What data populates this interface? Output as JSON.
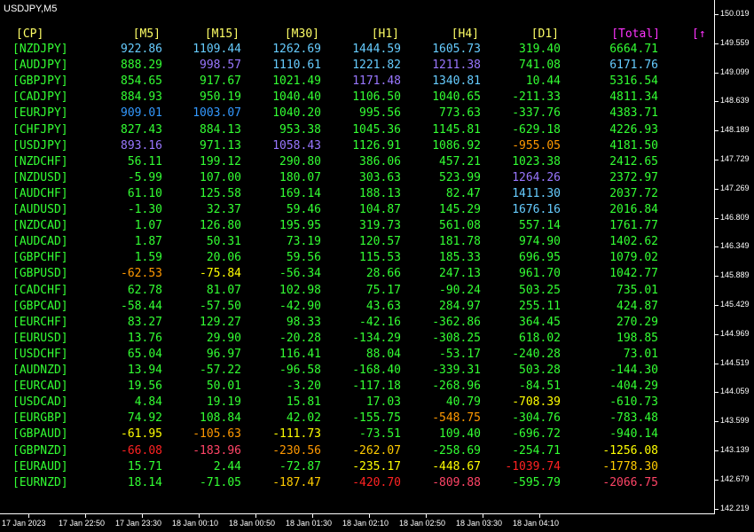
{
  "chart": {
    "title": "USDJPY,M5"
  },
  "colors": {
    "header_tf": "#ffff66",
    "header_total": "#ff33ff",
    "symbol": "#33ff33",
    "green": "#33ff33",
    "cyan": "#66ccff",
    "blue": "#3399ff",
    "purple": "#9977ff",
    "yellow": "#ffff00",
    "gold": "#ffcc00",
    "orange": "#ff9900",
    "red": "#ff2222",
    "pink": "#ff4466"
  },
  "table": {
    "headers": [
      "[CP]",
      "[M5]",
      "[M15]",
      "[M30]",
      "[H1]",
      "[H4]",
      "[D1]",
      "[Total]",
      "[↑"
    ],
    "rows": [
      {
        "symbol": "[NZDJPY]",
        "values": [
          "922.86",
          "1109.44",
          "1262.69",
          "1444.59",
          "1605.73",
          "319.40",
          "6664.71"
        ],
        "colors": [
          "cyan",
          "cyan",
          "cyan",
          "cyan",
          "cyan",
          "green",
          "green"
        ]
      },
      {
        "symbol": "[AUDJPY]",
        "values": [
          "888.29",
          "998.57",
          "1110.61",
          "1221.82",
          "1211.38",
          "741.08",
          "6171.76"
        ],
        "colors": [
          "green",
          "purple",
          "cyan",
          "cyan",
          "purple",
          "green",
          "cyan"
        ]
      },
      {
        "symbol": "[GBPJPY]",
        "values": [
          "854.65",
          "917.67",
          "1021.49",
          "1171.48",
          "1340.81",
          "10.44",
          "5316.54"
        ],
        "colors": [
          "green",
          "green",
          "green",
          "purple",
          "cyan",
          "green",
          "green"
        ]
      },
      {
        "symbol": "[CADJPY]",
        "values": [
          "884.93",
          "950.19",
          "1040.40",
          "1106.50",
          "1040.65",
          "-211.33",
          "4811.34"
        ],
        "colors": [
          "green",
          "green",
          "green",
          "green",
          "green",
          "green",
          "green"
        ]
      },
      {
        "symbol": "[EURJPY]",
        "values": [
          "909.01",
          "1003.07",
          "1040.20",
          "995.56",
          "773.63",
          "-337.76",
          "4383.71"
        ],
        "colors": [
          "blue",
          "blue",
          "green",
          "green",
          "green",
          "green",
          "green"
        ]
      },
      {
        "symbol": "[CHFJPY]",
        "values": [
          "827.43",
          "884.13",
          "953.38",
          "1045.36",
          "1145.81",
          "-629.18",
          "4226.93"
        ],
        "colors": [
          "green",
          "green",
          "green",
          "green",
          "green",
          "green",
          "green"
        ]
      },
      {
        "symbol": "[USDJPY]",
        "values": [
          "893.16",
          "971.13",
          "1058.43",
          "1126.91",
          "1086.92",
          "-955.05",
          "4181.50"
        ],
        "colors": [
          "purple",
          "green",
          "purple",
          "green",
          "green",
          "orange",
          "green"
        ]
      },
      {
        "symbol": "[NZDCHF]",
        "values": [
          "56.11",
          "199.12",
          "290.80",
          "386.06",
          "457.21",
          "1023.38",
          "2412.65"
        ],
        "colors": [
          "green",
          "green",
          "green",
          "green",
          "green",
          "green",
          "green"
        ]
      },
      {
        "symbol": "[NZDUSD]",
        "values": [
          "-5.99",
          "107.00",
          "180.07",
          "303.63",
          "523.99",
          "1264.26",
          "2372.97"
        ],
        "colors": [
          "green",
          "green",
          "green",
          "green",
          "green",
          "purple",
          "green"
        ]
      },
      {
        "symbol": "[AUDCHF]",
        "values": [
          "61.10",
          "125.58",
          "169.14",
          "188.13",
          "82.47",
          "1411.30",
          "2037.72"
        ],
        "colors": [
          "green",
          "green",
          "green",
          "green",
          "green",
          "cyan",
          "green"
        ]
      },
      {
        "symbol": "[AUDUSD]",
        "values": [
          "-1.30",
          "32.37",
          "59.46",
          "104.87",
          "145.29",
          "1676.16",
          "2016.84"
        ],
        "colors": [
          "green",
          "green",
          "green",
          "green",
          "green",
          "cyan",
          "green"
        ]
      },
      {
        "symbol": "[NZDCAD]",
        "values": [
          "1.07",
          "126.80",
          "195.95",
          "319.73",
          "561.08",
          "557.14",
          "1761.77"
        ],
        "colors": [
          "green",
          "green",
          "green",
          "green",
          "green",
          "green",
          "green"
        ]
      },
      {
        "symbol": "[AUDCAD]",
        "values": [
          "1.87",
          "50.31",
          "73.19",
          "120.57",
          "181.78",
          "974.90",
          "1402.62"
        ],
        "colors": [
          "green",
          "green",
          "green",
          "green",
          "green",
          "green",
          "green"
        ]
      },
      {
        "symbol": "[GBPCHF]",
        "values": [
          "1.59",
          "20.06",
          "59.56",
          "115.53",
          "185.33",
          "696.95",
          "1079.02"
        ],
        "colors": [
          "green",
          "green",
          "green",
          "green",
          "green",
          "green",
          "green"
        ]
      },
      {
        "symbol": "[GBPUSD]",
        "values": [
          "-62.53",
          "-75.84",
          "-56.34",
          "28.66",
          "247.13",
          "961.70",
          "1042.77"
        ],
        "colors": [
          "orange",
          "yellow",
          "green",
          "green",
          "green",
          "green",
          "green"
        ]
      },
      {
        "symbol": "[CADCHF]",
        "values": [
          "62.78",
          "81.07",
          "102.98",
          "75.17",
          "-90.24",
          "503.25",
          "735.01"
        ],
        "colors": [
          "green",
          "green",
          "green",
          "green",
          "green",
          "green",
          "green"
        ]
      },
      {
        "symbol": "[GBPCAD]",
        "values": [
          "-58.44",
          "-57.50",
          "-42.90",
          "43.63",
          "284.97",
          "255.11",
          "424.87"
        ],
        "colors": [
          "green",
          "green",
          "green",
          "green",
          "green",
          "green",
          "green"
        ]
      },
      {
        "symbol": "[EURCHF]",
        "values": [
          "83.27",
          "129.27",
          "98.33",
          "-42.16",
          "-362.86",
          "364.45",
          "270.29"
        ],
        "colors": [
          "green",
          "green",
          "green",
          "green",
          "green",
          "green",
          "green"
        ]
      },
      {
        "symbol": "[EURUSD]",
        "values": [
          "13.76",
          "29.90",
          "-20.28",
          "-134.29",
          "-308.25",
          "618.02",
          "198.85"
        ],
        "colors": [
          "green",
          "green",
          "green",
          "green",
          "green",
          "green",
          "green"
        ]
      },
      {
        "symbol": "[USDCHF]",
        "values": [
          "65.04",
          "96.97",
          "116.41",
          "88.04",
          "-53.17",
          "-240.28",
          "73.01"
        ],
        "colors": [
          "green",
          "green",
          "green",
          "green",
          "green",
          "green",
          "green"
        ]
      },
      {
        "symbol": "[AUDNZD]",
        "values": [
          "13.94",
          "-57.22",
          "-96.58",
          "-168.40",
          "-339.31",
          "503.28",
          "-144.30"
        ],
        "colors": [
          "green",
          "green",
          "green",
          "green",
          "green",
          "green",
          "green"
        ]
      },
      {
        "symbol": "[EURCAD]",
        "values": [
          "19.56",
          "50.01",
          "-3.20",
          "-117.18",
          "-268.96",
          "-84.51",
          "-404.29"
        ],
        "colors": [
          "green",
          "green",
          "green",
          "green",
          "green",
          "green",
          "green"
        ]
      },
      {
        "symbol": "[USDCAD]",
        "values": [
          "4.84",
          "19.19",
          "15.81",
          "17.03",
          "40.79",
          "-708.39",
          "-610.73"
        ],
        "colors": [
          "green",
          "green",
          "green",
          "green",
          "green",
          "yellow",
          "green"
        ]
      },
      {
        "symbol": "[EURGBP]",
        "values": [
          "74.92",
          "108.84",
          "42.02",
          "-155.75",
          "-548.75",
          "-304.76",
          "-783.48"
        ],
        "colors": [
          "green",
          "green",
          "green",
          "green",
          "orange",
          "green",
          "green"
        ]
      },
      {
        "symbol": "[GBPAUD]",
        "values": [
          "-61.95",
          "-105.63",
          "-111.73",
          "-73.51",
          "109.40",
          "-696.72",
          "-940.14"
        ],
        "colors": [
          "yellow",
          "orange",
          "yellow",
          "green",
          "green",
          "green",
          "green"
        ]
      },
      {
        "symbol": "[GBPNZD]",
        "values": [
          "-66.08",
          "-183.96",
          "-230.56",
          "-262.07",
          "-258.69",
          "-254.71",
          "-1256.08"
        ],
        "colors": [
          "red",
          "pink",
          "orange",
          "gold",
          "green",
          "green",
          "yellow"
        ]
      },
      {
        "symbol": "[EURAUD]",
        "values": [
          "15.71",
          "2.44",
          "-72.87",
          "-235.17",
          "-448.67",
          "-1039.74",
          "-1778.30"
        ],
        "colors": [
          "green",
          "green",
          "green",
          "yellow",
          "yellow",
          "red",
          "gold"
        ]
      },
      {
        "symbol": "[EURNZD]",
        "values": [
          "18.14",
          "-71.05",
          "-187.47",
          "-420.70",
          "-809.88",
          "-595.79",
          "-2066.75"
        ],
        "colors": [
          "green",
          "green",
          "gold",
          "red",
          "pink",
          "green",
          "pink"
        ]
      }
    ]
  },
  "price_axis": [
    "150.019",
    "149.559",
    "149.099",
    "148.639",
    "148.189",
    "147.729",
    "147.269",
    "146.809",
    "146.349",
    "145.889",
    "145.429",
    "144.969",
    "144.519",
    "144.059",
    "143.599",
    "143.139",
    "142.679",
    "142.219"
  ],
  "time_axis": [
    "17 Jan 2023",
    "17 Jan 22:50",
    "17 Jan 23:30",
    "18 Jan 00:10",
    "18 Jan 00:50",
    "18 Jan 01:30",
    "18 Jan 02:10",
    "18 Jan 02:50",
    "18 Jan 03:30",
    "18 Jan 04:10"
  ]
}
